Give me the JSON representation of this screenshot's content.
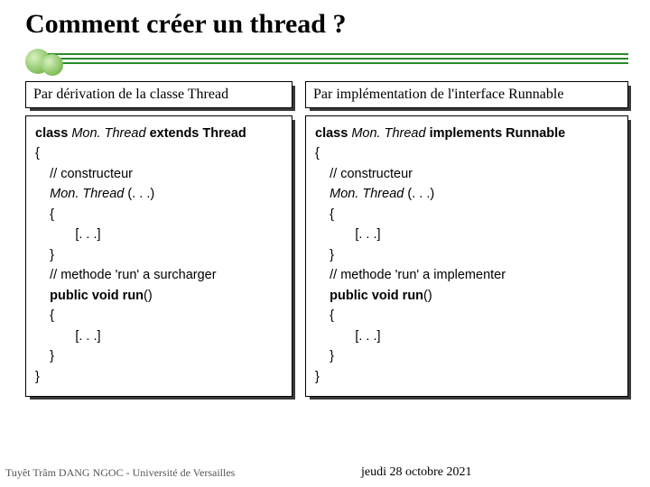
{
  "title": "Comment créer un thread ?",
  "left": {
    "heading": "Par dérivation de la classe Thread",
    "code": {
      "l1a": "class ",
      "l1b": "Mon. Thread",
      "l1c": " extends Thread",
      "l2": "{",
      "l3a": "    // constructeur",
      "l4a": "    ",
      "l4b": "Mon. Thread",
      "l4c": " (. . .)",
      "l5": "    {",
      "l6": "           [. . .]",
      "l7": "    }",
      "l8": "    // methode 'run' a surcharger",
      "l9a": "    ",
      "l9b": "public void run",
      "l9c": "()",
      "l10": "    {",
      "l11": "           [. . .]",
      "l12": "    }",
      "l13": "}"
    }
  },
  "right": {
    "heading": "Par implémentation de l'interface Runnable",
    "code": {
      "l1a": "class ",
      "l1b": "Mon. Thread",
      "l1c": " implements Runnable",
      "l2": "{",
      "l3a": "    // constructeur",
      "l4a": "    ",
      "l4b": "Mon. Thread",
      "l4c": " (. . .)",
      "l5": "    {",
      "l6": "           [. . .]",
      "l7": "    }",
      "l8": "    // methode 'run' a implementer",
      "l9a": "    ",
      "l9b": "public void run",
      "l9c": "()",
      "l10": "    {",
      "l11": "           [. . .]",
      "l12": "    }",
      "l13": "}"
    }
  },
  "footer": {
    "left": "Tuyêt Trâm DANG NGOC - Université de Versailles",
    "right": "jeudi 28 octobre 2021"
  }
}
